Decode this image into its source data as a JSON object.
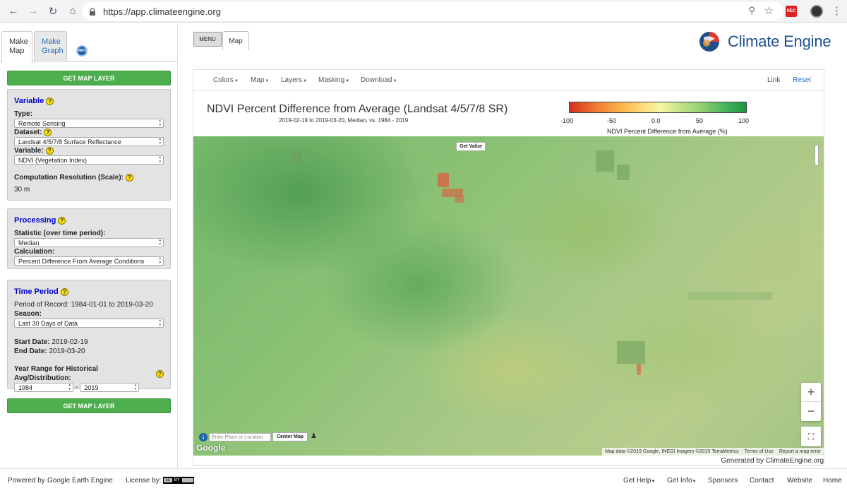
{
  "browser": {
    "url": "https://app.climateengine.org"
  },
  "left": {
    "tabs": {
      "make_map": "Make Map",
      "make_graph": "Make Graph"
    },
    "info_badge": "INFO",
    "get_map_layer": "GET MAP LAYER",
    "variable": {
      "title": "Variable",
      "type_label": "Type:",
      "type_value": "Remote Sensing",
      "dataset_label": "Dataset:",
      "dataset_value": "Landsat 4/5/7/8 Surface Reflectance",
      "variable_label": "Variable:",
      "variable_value": "NDVI (Vegetation Index)",
      "resolution_label": "Computation Resolution (Scale):",
      "resolution_value": "30 m"
    },
    "processing": {
      "title": "Processing",
      "statistic_label": "Statistic (over time period):",
      "statistic_value": "Median",
      "calculation_label": "Calculation:",
      "calculation_value": "Percent Difference From Average Conditions"
    },
    "time_period": {
      "title": "Time Period",
      "period_of_record": "Period of Record: 1984-01-01 to 2019-03-20",
      "season_label": "Season:",
      "season_value": "Last 30 Days of Data",
      "start_label": "Start Date:",
      "start_value": "2019-02-19",
      "end_label": "End Date:",
      "end_value": "2019-03-20",
      "year_range_label": "Year Range for Historical Avg/Distribution:",
      "year_from": "1984",
      "year_sep": "-",
      "year_to": "2019"
    }
  },
  "header": {
    "menu": "MENU",
    "map_tab": "Map",
    "logo_text": "Climate Engine"
  },
  "navbar": {
    "colors": "Colors",
    "map": "Map",
    "layers": "Layers",
    "masking": "Masking",
    "download": "Download",
    "link": "Link",
    "reset": "Reset"
  },
  "map": {
    "title": "NDVI Percent Difference from Average (Landsat 4/5/7/8 SR)",
    "subtitle": "2019-02-19 to 2019-03-20, Median, vs. 1984 - 2019",
    "legend": {
      "ticks": [
        "-100",
        "-50",
        "0.0",
        "50",
        "100"
      ],
      "title": "NDVI Percent Difference from Average (%)",
      "colors": [
        "#d7301f",
        "#fbb74a",
        "#f5f7a0",
        "#8fd071",
        "#1a9641"
      ]
    },
    "get_value": "Get Value",
    "location_placeholder": "Enter Place or Location",
    "center_map": "Center Map",
    "google": "Google",
    "attribution": "Map data ©2019 Google, INEGI Imagery ©2019 TerraMetrics",
    "terms": "Terms of Use",
    "report": "Report a map error",
    "generated": "Generated by ClimateEngine.org"
  },
  "footer": {
    "powered_by": "Powered by",
    "gee": "Google Earth Engine",
    "license": "License by:",
    "get_help": "Get Help",
    "get_info": "Get Info",
    "sponsors": "Sponsors",
    "contact": "Contact",
    "website": "Website",
    "home": "Home"
  }
}
